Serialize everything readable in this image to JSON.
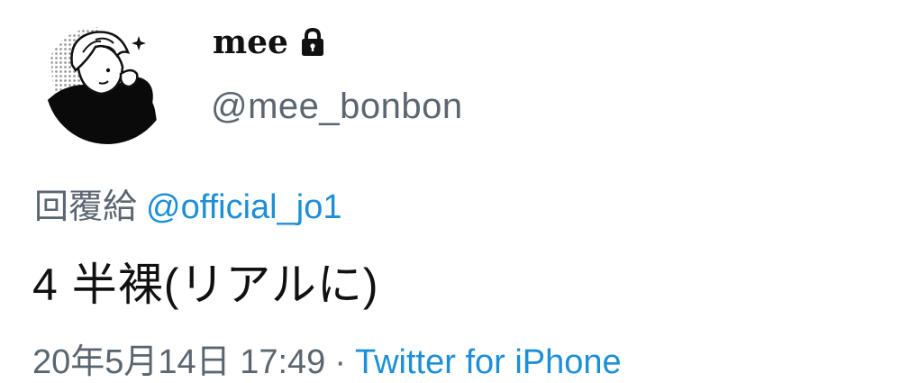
{
  "profile": {
    "display_name": "mee",
    "handle": "@mee_bonbon",
    "avatar_icon": "cartoon-boy-avatar-icon",
    "protected_icon": "lock-icon"
  },
  "reply": {
    "prefix": "回覆給",
    "mention": "@official_jo1"
  },
  "tweet": {
    "text": "4 半裸(リアルに)"
  },
  "meta": {
    "timestamp": "20年5月14日 17:49",
    "separator": "·",
    "source": "Twitter for iPhone"
  },
  "colors": {
    "text": "#111111",
    "secondary": "#5b6670",
    "link": "#1d8fd6"
  }
}
